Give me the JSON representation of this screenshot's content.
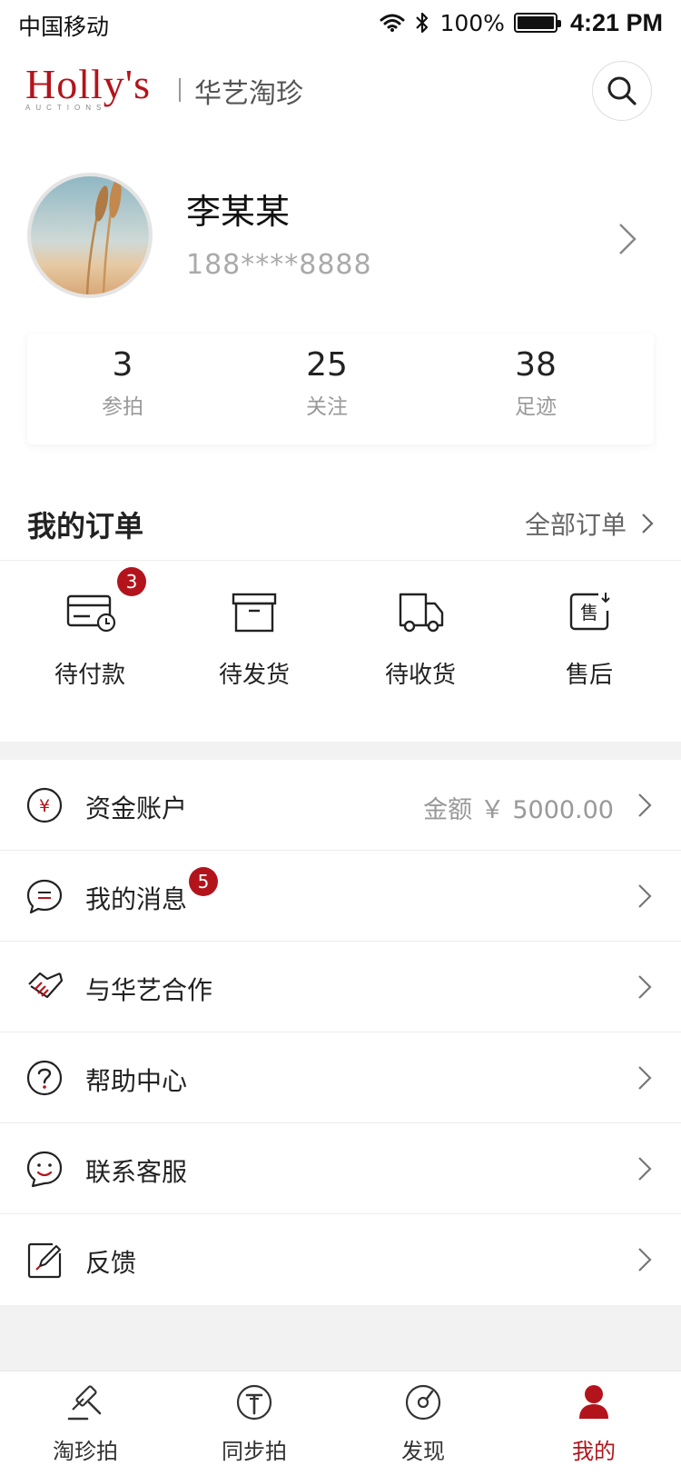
{
  "status_bar": {
    "carrier": "中国移动",
    "battery": "100%",
    "time": "4:21 PM"
  },
  "header": {
    "logo": "Holly's",
    "logo_sub": "AUCTIONS",
    "brand_cn": "华艺淘珍",
    "search_icon": "search-icon"
  },
  "profile": {
    "name": "李某某",
    "phone": "188****8888",
    "stats": [
      {
        "value": "3",
        "label": "参拍"
      },
      {
        "value": "25",
        "label": "关注"
      },
      {
        "value": "38",
        "label": "足迹"
      }
    ]
  },
  "orders": {
    "title": "我的订单",
    "all_label": "全部订单",
    "items": [
      {
        "label": "待付款",
        "icon": "card-clock-icon",
        "badge": "3"
      },
      {
        "label": "待发货",
        "icon": "box-icon"
      },
      {
        "label": "待收货",
        "icon": "truck-icon"
      },
      {
        "label": "售后",
        "icon": "after-sale-icon"
      }
    ]
  },
  "menu": [
    {
      "label": "资金账户",
      "icon": "yuan-icon",
      "value": "金额 ￥ 5000.00"
    },
    {
      "label": "我的消息",
      "icon": "message-icon",
      "badge": "5"
    },
    {
      "label": "与华艺合作",
      "icon": "handshake-icon"
    },
    {
      "label": "帮助中心",
      "icon": "help-icon"
    },
    {
      "label": "联系客服",
      "icon": "service-icon"
    },
    {
      "label": "反馈",
      "icon": "feedback-icon"
    }
  ],
  "tabbar": [
    {
      "label": "淘珍拍",
      "icon": "gavel-icon"
    },
    {
      "label": "同步拍",
      "icon": "sync-auction-icon"
    },
    {
      "label": "发现",
      "icon": "discover-icon"
    },
    {
      "label": "我的",
      "icon": "user-icon",
      "active": true
    }
  ],
  "colors": {
    "accent": "#b3141b",
    "background": "#f2f2f2"
  }
}
